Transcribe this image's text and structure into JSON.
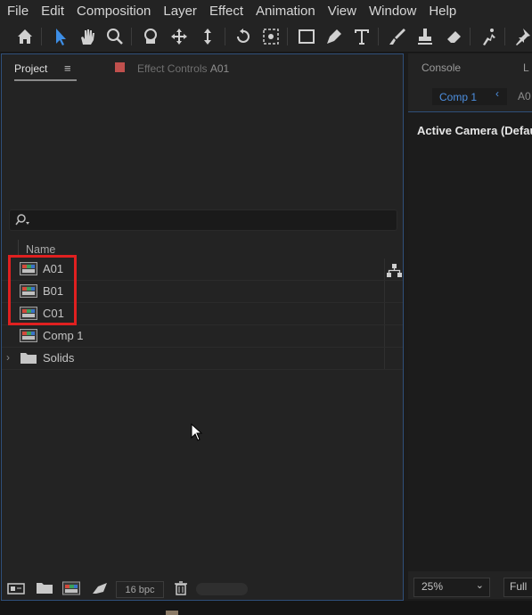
{
  "menu": [
    "File",
    "Edit",
    "Composition",
    "Layer",
    "Effect",
    "Animation",
    "View",
    "Window",
    "Help"
  ],
  "toolbar": {
    "tools": [
      "home-icon",
      "selection-arrow-icon",
      "hand-icon",
      "zoom-icon",
      "orbit-camera-icon",
      "pan-camera-icon",
      "dolly-camera-icon",
      "rotate-icon",
      "pan-behind-icon",
      "rectangle-icon",
      "pen-icon",
      "type-icon",
      "brush-icon",
      "clone-stamp-icon",
      "eraser-icon",
      "roto-brush-icon",
      "puppet-pin-icon"
    ]
  },
  "project_panel": {
    "tab_label": "Project",
    "menu_glyph": "≡",
    "effect_controls_label": "Effect Controls",
    "effect_controls_target": "A01",
    "column_name": "Name",
    "items": [
      {
        "label": "A01",
        "type": "composition",
        "highlighted": true
      },
      {
        "label": "B01",
        "type": "composition",
        "highlighted": true
      },
      {
        "label": "C01",
        "type": "composition",
        "highlighted": true
      },
      {
        "label": "Comp 1",
        "type": "composition",
        "highlighted": false
      },
      {
        "label": "Solids",
        "type": "folder",
        "highlighted": false
      }
    ],
    "bit_depth": "16 bpc"
  },
  "right_panel": {
    "console_label": "Console",
    "tab_fragment": "L",
    "comp_tab_label": "Comp 1",
    "comp_tab_arrow": "‹",
    "second_tab_fragment": "A0",
    "viewer_label": "Active Camera (Defau",
    "zoom": "25%",
    "zoom_caret": "⌄",
    "resolution": "Full"
  },
  "colors": {
    "accent_blue": "#4d8fe0",
    "highlight_red": "#e02020",
    "effect_controls_swatch": "#c0504d"
  }
}
